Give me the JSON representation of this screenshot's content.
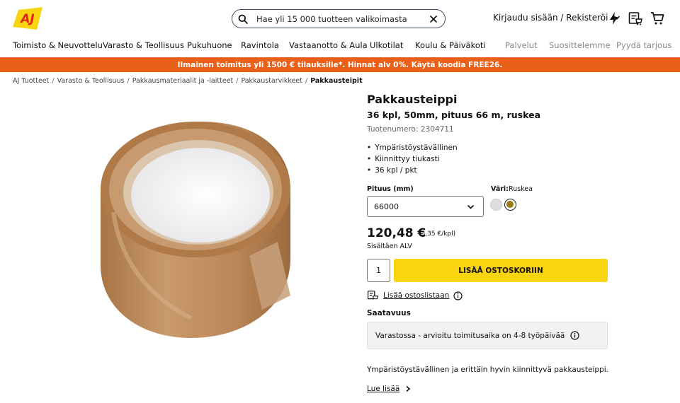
{
  "header": {
    "logo_text": "AJ",
    "search_placeholder": "Hae yli 15 000 tuotteen valikoimasta",
    "login_label": "Kirjaudu sisään / Rekisteröi"
  },
  "icons": {
    "logo": "aj-logo",
    "search": "search-icon",
    "clear": "close-icon",
    "login_chevron": "chevron-down-icon",
    "quick_order": "lightning-icon",
    "shopping_list": "shopping-list-icon",
    "cart": "cart-icon",
    "info": "info-icon",
    "more_chevron": "chevron-right-icon"
  },
  "nav": {
    "items": [
      "Toimisto & Neuvottelu",
      "Varasto & Teollisuus",
      "Pukuhuone",
      "Ravintola",
      "Vastaanotto & Aula",
      "Ulkotilat",
      "Koulu & Päiväkoti"
    ],
    "secondary": [
      "Palvelut",
      "Suosittelemme",
      "Pyydä tarjous"
    ]
  },
  "banner": {
    "text": "Ilmainen toimitus yli 1500 € tilauksille*. Hinnat alv 0%. Käytä koodia FREE26."
  },
  "breadcrumb": [
    "AJ Tuotteet",
    "Varasto & Teollisuus",
    "Pakkausmateriaalit ja -laitteet",
    "Pakkaustarvikkeet",
    "Pakkausteipit"
  ],
  "product": {
    "title": "Pakkausteippi",
    "subtitle": "36 kpl, 50mm, pituus 66 m, ruskea",
    "sku": "Tuotenumero: 2304711",
    "bullets": [
      "Ympäristöystävällinen",
      "Kiinnittyy tiukasti",
      "36 kpl / pkt"
    ],
    "length_label": "Pituus (mm)",
    "length_value": "66000",
    "color_label": "Väri:",
    "color_value": "Ruskea",
    "swatches": [
      "#dddddd",
      "#9c7a18"
    ],
    "price": "120,48 €",
    "unit_price": "(3,35 €/kpl)",
    "vat_note": "Sisältäen ALV",
    "quantity": "1",
    "add_to_cart": "LISÄÄ OSTOSKORIIN",
    "wishlist": "Lisää ostoslistaan",
    "availability_heading": "Saatavuus",
    "availability_text": "Varastossa - arvioitu toimitusaika on 4-8 työpäivää",
    "description": "Ympäristöystävällinen ja erittäin hyvin kiinnittyvä pakkausteippi.",
    "read_more": "Lue lisää"
  },
  "colors": {
    "banner": "#e8601a",
    "cart_button": "#f9d511",
    "logo_red": "#e2231a",
    "logo_yellow": "#f9d511",
    "tape": "#b9865a"
  }
}
